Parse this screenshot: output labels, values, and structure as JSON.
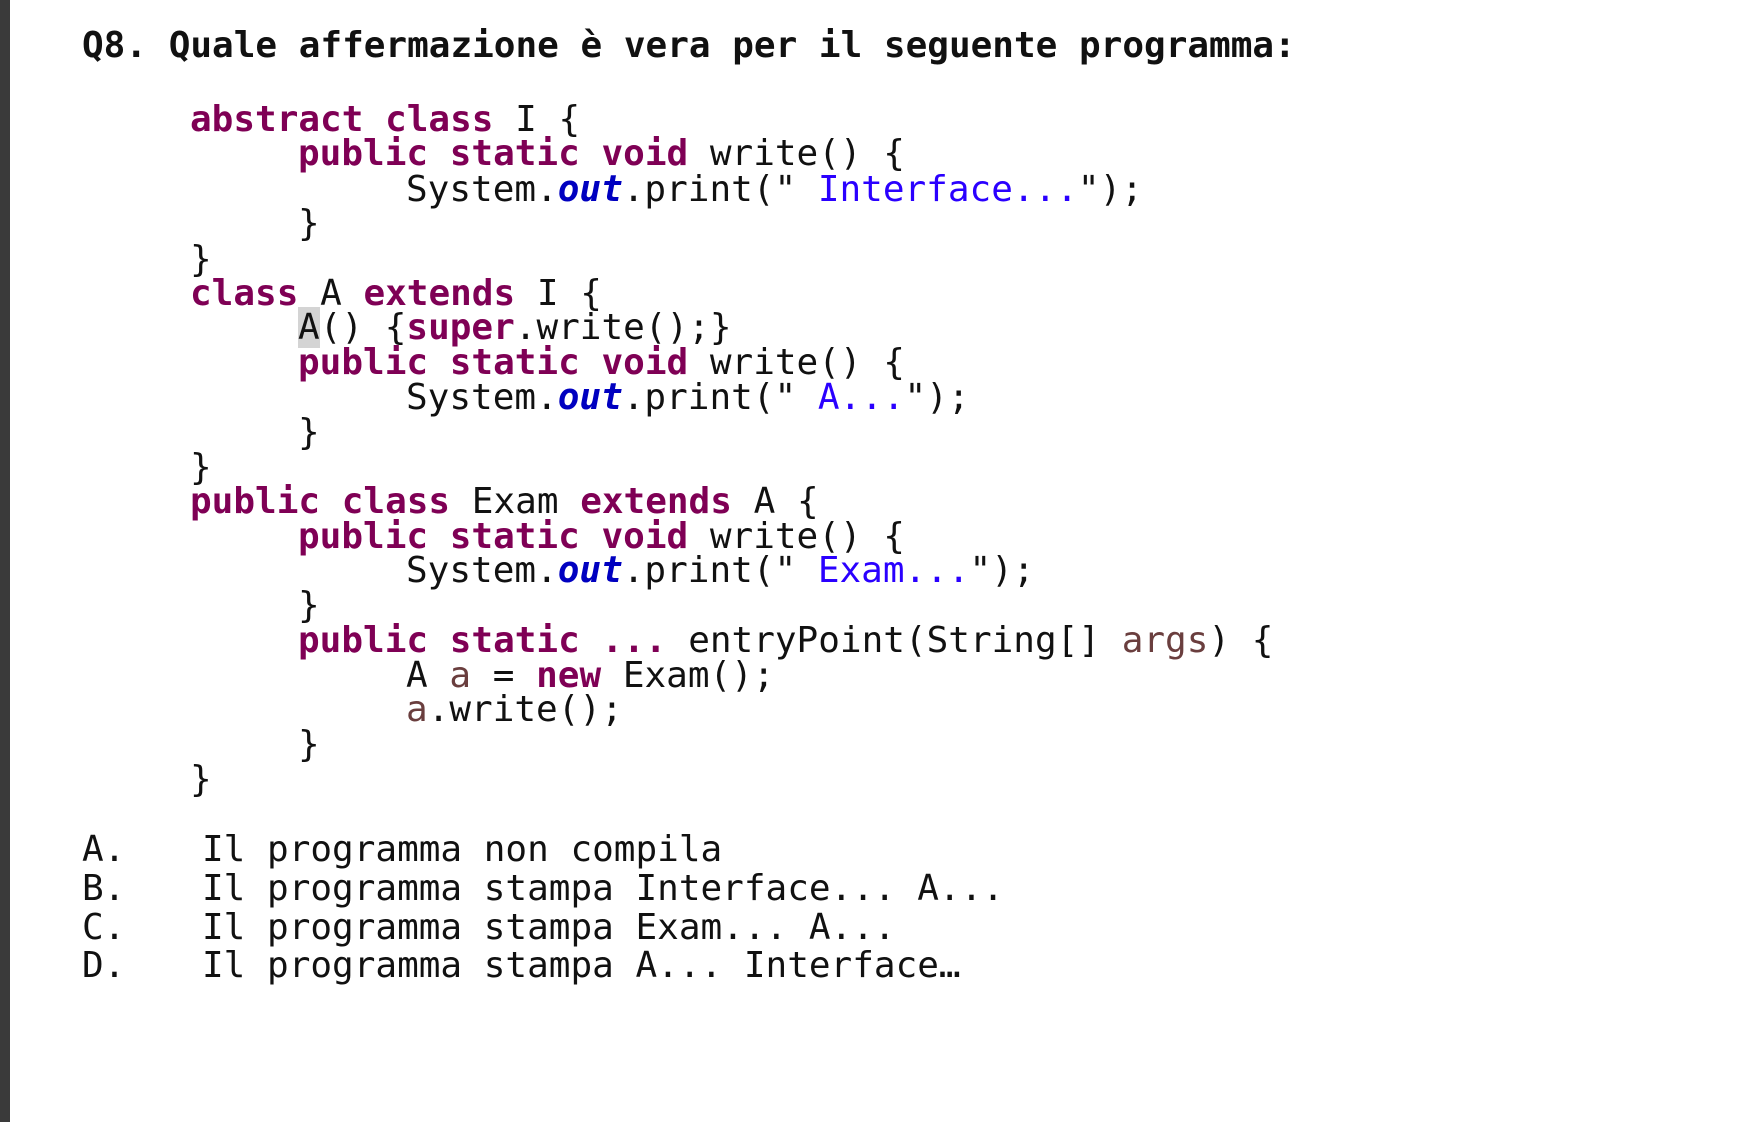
{
  "question": "Q8. Quale affermazione è vera per il seguente programma:",
  "code": {
    "kw_abstract": "abstract",
    "kw_class": "class",
    "kw_public": "public",
    "kw_static": "static",
    "kw_void": "void",
    "kw_extends": "extends",
    "kw_super": "super",
    "kw_new": "new",
    "ident_I": "I",
    "ident_A": "A",
    "ident_Exam": "Exam",
    "ident_a": "a",
    "ident_args": "args",
    "method_write": "write()",
    "method_entry": "entryPoint(String[]",
    "system": "System.",
    "out": "out",
    "print": ".print(\"",
    "str_interface": " Interface...",
    "str_a": " A...",
    "str_exam": " Exam...",
    "ellipsis": "...",
    "ctor_call": ".write();}",
    "exam_call": "Exam();",
    "a_write_call": ".write();"
  },
  "answers": [
    {
      "letter": "A.",
      "text": "Il programma non compila"
    },
    {
      "letter": "B.",
      "text": "Il programma stampa Interface... A..."
    },
    {
      "letter": "C.",
      "text": "Il programma stampa Exam... A..."
    },
    {
      "letter": "D.",
      "text": "Il programma stampa A... Interface…"
    }
  ]
}
